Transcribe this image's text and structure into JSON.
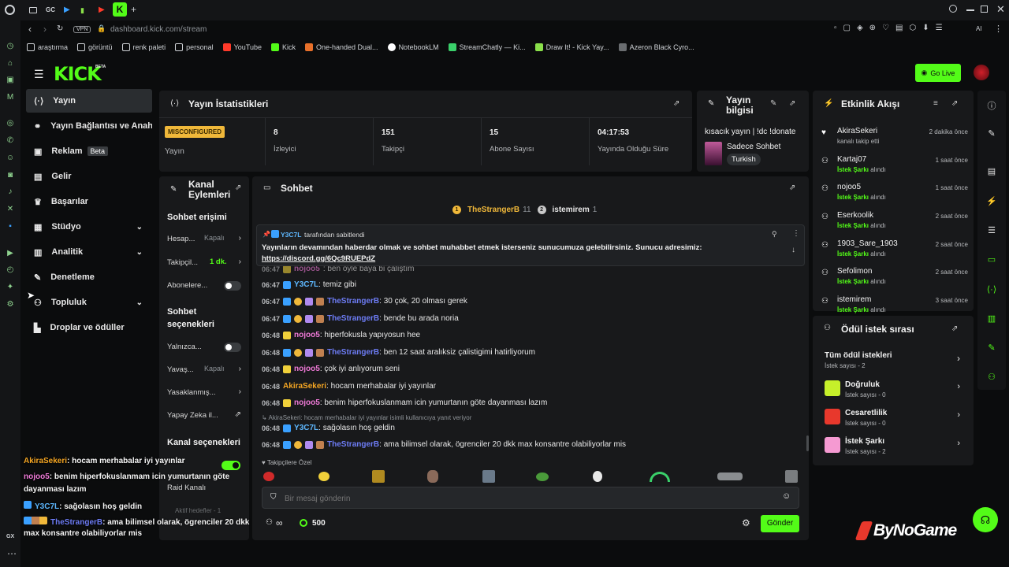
{
  "browser": {
    "tabs": [
      "GC"
    ],
    "vpn": "VPN",
    "url": "dashboard.kick.com/stream",
    "bookmarks": [
      "araştırma",
      "görüntü",
      "renk paleti",
      "personal",
      "YouTube",
      "Kick",
      "One-handed Dual...",
      "NotebookLM",
      "StreamChatly — Ki...",
      "Draw It! - Kick Yay...",
      "Azeron Black Cyro..."
    ],
    "rail_bottom": "GX"
  },
  "header": {
    "logo": "KICK",
    "beta": "BETA",
    "go_live": "Go Live"
  },
  "nav": [
    {
      "label": "Yayın",
      "active": true
    },
    {
      "label": "Yayın Bağlantısı ve Anahtarı"
    },
    {
      "label": "Reklam",
      "badge": "Beta"
    },
    {
      "label": "Gelir"
    },
    {
      "label": "Başarılar"
    },
    {
      "label": "Stüdyo"
    },
    {
      "label": "Analitik"
    },
    {
      "label": "Denetleme"
    },
    {
      "label": "Topluluk"
    },
    {
      "label": "Droplar ve ödüller"
    }
  ],
  "stats": {
    "title": "Yayın İstatistikleri",
    "status": "MISCONFIGURED",
    "status_label": "Yayın",
    "items": [
      {
        "value": "8",
        "label": "İzleyici"
      },
      {
        "value": "151",
        "label": "Takipçi"
      },
      {
        "value": "15",
        "label": "Abone Sayısı"
      },
      {
        "value": "04:17:53",
        "label": "Yayında Olduğu Süre"
      }
    ]
  },
  "info": {
    "title_line1": "Yayın",
    "title_line2": "bilgisi",
    "stream_title": "kısacık yayın | !dc !donate",
    "category": "Sadece Sohbet",
    "language": "Turkish"
  },
  "actions": {
    "title_line1": "Kanal",
    "title_line2": "Eylemleri",
    "chat_access": "Sohbet erişimi",
    "rows1": [
      {
        "label": "Hesap...",
        "value": "Kapalı"
      },
      {
        "label": "Takipçil...",
        "value": "1 dk."
      },
      {
        "label": "Abonelere..."
      }
    ],
    "chat_options_1": "Sohbet",
    "chat_options_2": "seçenekleri",
    "rows2": [
      {
        "label": "Yalnızca..."
      },
      {
        "label": "Yavaş...",
        "value": "Kapalı"
      },
      {
        "label": "Yasaklanmış..."
      },
      {
        "label": "Yapay Zeka il..."
      }
    ],
    "channel_options": "Kanal seçenekleri",
    "raid": "Raid Kanalı",
    "goals": "Aktif hedefler - 1"
  },
  "chat": {
    "title": "Sohbet",
    "top_gifters": [
      {
        "name": "TheStrangerB",
        "count": "11",
        "rank": "1"
      },
      {
        "name": "istemirem",
        "count": "1",
        "rank": "2"
      }
    ],
    "pinned_by": "Y3C7L",
    "pinned_suffix": "tarafından sabitlendi",
    "pinned_text": "Yayınların devamından haberdar olmak ve sohbet muhabbet etmek isterseniz sunucumuza gelebilirsiniz. Sunucu adresimiz:",
    "pinned_link": "https://discord.gg/6Qc9RUEPdZ",
    "partial_line": {
      "time": "06:47",
      "user": "nojoo5",
      "text": ": ben öyle baya bi çalıştım"
    },
    "messages": [
      {
        "time": "06:47",
        "user": "Y3C7L",
        "color": "#5eb8ff",
        "text": ": temiz gibi"
      },
      {
        "time": "06:47",
        "user": "TheStrangerB",
        "color": "#6d7cf5",
        "text": ": 30 çok, 20 olması gerek"
      },
      {
        "time": "06:47",
        "user": "TheStrangerB",
        "color": "#6d7cf5",
        "text": ": bende bu arada noria"
      },
      {
        "time": "06:48",
        "user": "nojoo5",
        "color": "#f07ad8",
        "text": ": hiperfokusla yapıyosun hee"
      },
      {
        "time": "06:48",
        "user": "TheStrangerB",
        "color": "#6d7cf5",
        "text": ": ben 12 saat aralıksiz çalistigimi hatirliyorum"
      },
      {
        "time": "06:48",
        "user": "nojoo5",
        "color": "#f07ad8",
        "text": ": çok iyi anlıyorum seni"
      },
      {
        "time": "06:48",
        "user": "AkiraSekeri",
        "color": "#f5a623",
        "text": ": hocam merhabalar iyi yayınlar"
      },
      {
        "time": "06:48",
        "user": "nojoo5",
        "color": "#f07ad8",
        "text": ": benim hiperfokuslanmam icin yumurtanın göte dayanması lazım"
      },
      {
        "time": "06:48",
        "user": "Y3C7L",
        "color": "#5eb8ff",
        "text": ": sağolasın hoş geldin"
      },
      {
        "time": "06:48",
        "user": "TheStrangerB",
        "color": "#6d7cf5",
        "text": ": ama bilimsel olarak, ögrenciler 20 dkk max konsantre olabiliyorlar mis"
      }
    ],
    "reply_note": "AkiraSekeri: hocam merhabalar iyi yayınlar isimli kullanıcıya yanıt veriyor",
    "followers_only": "Takipçilere Özel",
    "input_placeholder": "Bir mesaj gönderin",
    "points": "500",
    "send": "Gönder"
  },
  "events": {
    "title": "Etkinlik Akışı",
    "items": [
      {
        "name": "AkiraSekeri",
        "sub_plain": "kanalı takip etti",
        "time": "2 dakika önce",
        "icon": "heart-icon"
      },
      {
        "name": "Kartaj07",
        "sub_bold": "İstek Şarkı",
        "sub_plain": " alındı",
        "time": "1 saat önce",
        "icon": "reward-icon"
      },
      {
        "name": "nojoo5",
        "sub_bold": "İstek Şarkı",
        "sub_plain": " alındı",
        "time": "1 saat önce",
        "icon": "reward-icon"
      },
      {
        "name": "Eserkoolik",
        "sub_bold": "İstek Şarkı",
        "sub_plain": " alındı",
        "time": "2 saat önce",
        "icon": "reward-icon"
      },
      {
        "name": "1903_Sare_1903",
        "sub_bold": "İstek Şarkı",
        "sub_plain": " alındı",
        "time": "2 saat önce",
        "icon": "reward-icon"
      },
      {
        "name": "Sefolimon",
        "sub_bold": "İstek Şarkı",
        "sub_plain": " alındı",
        "time": "2 saat önce",
        "icon": "reward-icon"
      },
      {
        "name": "istemirem",
        "sub_bold": "İstek Şarkı",
        "sub_plain": " alındı",
        "time": "3 saat önce",
        "icon": "reward-icon"
      }
    ]
  },
  "rewards": {
    "title": "Ödül istek sırası",
    "all_label": "Tüm ödül istekleri",
    "all_count": "İstek sayısı - 2",
    "items": [
      {
        "name": "Doğruluk",
        "count": "İstek sayısı - 0",
        "color": "#c6f02a"
      },
      {
        "name": "Cesaretlilik",
        "count": "İstek sayısı - 0",
        "color": "#e8382c"
      },
      {
        "name": "İstek Şarkı",
        "count": "İstek sayısı - 2",
        "color": "#f59ad2"
      }
    ]
  },
  "overlay": {
    "lines": [
      {
        "user": "AkiraSekeri",
        "color": "#f5a623",
        "text": ": hocam merhabalar iyi yayınlar"
      },
      {
        "user": "nojoo5",
        "color": "#f07ad8",
        "text": ": benim hiperfokuslanmam icin yumurtanın göte"
      },
      {
        "cont": "dayanması lazım"
      },
      {
        "user": "Y3C7L",
        "color": "#5eb8ff",
        "text": ": sağolasın hoş geldin"
      },
      {
        "user": "TheStrangerB",
        "color": "#6d7cf5",
        "text": ": ama bilimsel olarak, ögrenciler 20 dkk"
      },
      {
        "cont": "max konsantre olabiliyorlar mis"
      }
    ]
  },
  "watermark": "ByNoGame",
  "colors": {
    "accent": "#53fc18",
    "panel": "#18191b",
    "bg": "#0b0c0d"
  }
}
